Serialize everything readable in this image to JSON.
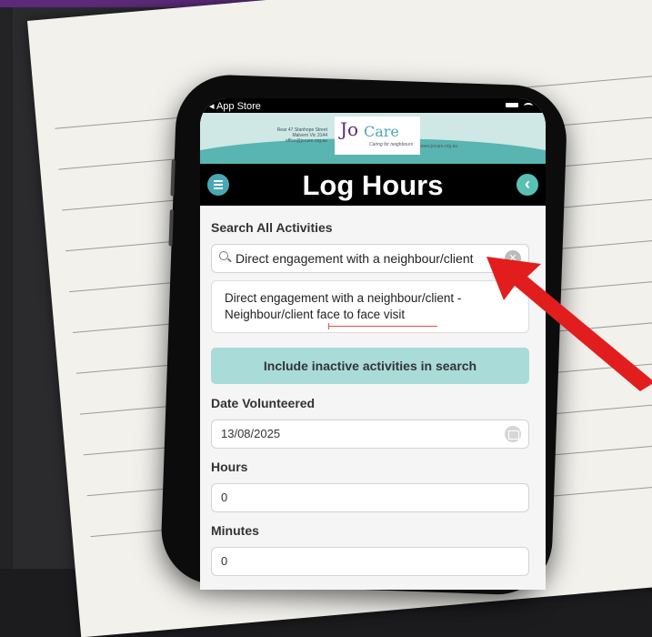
{
  "status_bar": {
    "back_app": "◂ App Store"
  },
  "banner": {
    "address_line1": "Rear 47 Stanhope Street",
    "address_line2": "Malvern Vic 3144",
    "address_line3": "office@jocare.org.au",
    "logo_jo": "Jo",
    "logo_care": "Care",
    "tagline": "Caring for neighbours",
    "website": "www.jocare.org.au"
  },
  "header": {
    "title": "Log Hours",
    "menu_icon": "menu-icon",
    "back_icon": "chevron-left-icon"
  },
  "search": {
    "label": "Search All Activities",
    "value": "Direct engagement with a neighbour/client",
    "icon": "search-icon",
    "clear_icon": "clear-icon"
  },
  "result": {
    "line1": "Direct engagement with a neighbour/client -",
    "line2": "Neighbour/client face to face visit"
  },
  "inactive_button": {
    "label": "Include inactive activities in search"
  },
  "date": {
    "label": "Date Volunteered",
    "value": "13/08/2025",
    "icon": "calendar-icon"
  },
  "hours": {
    "label": "Hours",
    "value": "0"
  },
  "minutes": {
    "label": "Minutes",
    "value": "0"
  },
  "colors": {
    "accent_teal": "#4aa8b4",
    "button_teal": "#a9dcd8",
    "brand_purple": "#5b2a7a",
    "arrow_red": "#e21d1d"
  }
}
